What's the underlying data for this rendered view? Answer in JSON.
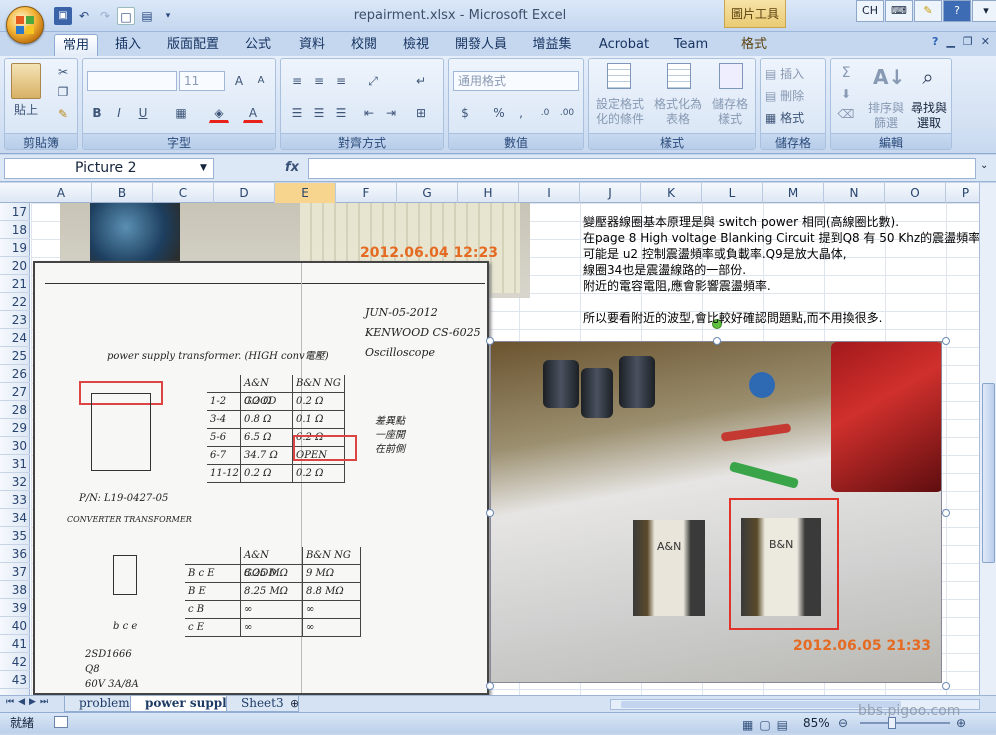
{
  "window": {
    "title": "repairment.xlsx - Microsoft Excel",
    "context_tool_label": "圖片工具",
    "sys_buttons": [
      "CH",
      "?"
    ]
  },
  "tabs": [
    "常用",
    "插入",
    "版面配置",
    "公式",
    "資料",
    "校閱",
    "檢視",
    "開發人員",
    "增益集",
    "Acrobat",
    "Team",
    "格式"
  ],
  "ribbon": {
    "clipboard": {
      "label": "剪貼簿",
      "paste": "貼上"
    },
    "font": {
      "label": "字型",
      "size": "11",
      "bold": "B",
      "italic": "I",
      "underline": "U"
    },
    "alignment": {
      "label": "對齊方式"
    },
    "number": {
      "label": "數值",
      "format": "通用格式",
      "percent": "%",
      "comma": ","
    },
    "styles": {
      "label": "樣式",
      "cond_format": "設定格式化的條件",
      "as_table": "格式化為表格",
      "cell_styles": "儲存格樣式"
    },
    "cells": {
      "label": "儲存格",
      "insert": "插入",
      "delete": "刪除",
      "format": "格式"
    },
    "editing": {
      "label": "編輯",
      "sigma": "Σ",
      "sort": "排序與篩選",
      "find": "尋找與選取"
    }
  },
  "formula_bar": {
    "name_box": "Picture 2",
    "fx": "fx",
    "value": ""
  },
  "columns": [
    "A",
    "B",
    "C",
    "D",
    "E",
    "F",
    "G",
    "H",
    "I",
    "J",
    "K",
    "L",
    "M",
    "N",
    "O",
    "P"
  ],
  "rows": [
    "17",
    "18",
    "19",
    "20",
    "21",
    "22",
    "23",
    "24",
    "25",
    "26",
    "27",
    "28",
    "29",
    "30",
    "31",
    "32",
    "33",
    "34",
    "35",
    "36",
    "37",
    "38",
    "39",
    "40",
    "41",
    "42",
    "43"
  ],
  "note_lines": [
    "變壓器線圈基本原理是與  switch power 相同(高線圈比數).",
    "在page 8 High voltage  Blanking Circuit  提到Q8 有 50 Khz的震盪頻率,",
    "可能是 u2 控制震盪頻率或負載率.Q9是放大晶体,",
    "線圈34也是震盪線路的一部份.",
    "附近的電容電阻,應會影響震盪頻率.",
    "",
    "所以要看附近的波型,會比較好確認問題點,而不用換很多."
  ],
  "photos": {
    "top_timestamp": "2012.06.04 12:23",
    "main_timestamp": "2012.06.05 21:33",
    "label_left": "A&N",
    "label_right": "B&N"
  },
  "handwritten": {
    "date": "JUN-05-2012",
    "model": "KENWOOD CS-6025",
    "device": "Oscilloscope",
    "title": "power supply transformer. (HIGH conv電壓)",
    "pn": "P/N: L19-0427-05",
    "pn_sub": "CONVERTER TRANSFORMER",
    "table1_head": [
      "",
      "A&N GOOD",
      "B&N NG"
    ],
    "table1_rows": [
      [
        "1-2",
        "0.2 Ω",
        "0.2 Ω"
      ],
      [
        "3-4",
        "0.8 Ω",
        "0.1 Ω"
      ],
      [
        "5-6",
        "6.5 Ω",
        "6.2 Ω"
      ],
      [
        "6-7",
        "34.7 Ω",
        "OPEN"
      ],
      [
        "11-12",
        "0.2 Ω",
        "0.2 Ω"
      ]
    ],
    "side_note": [
      "差異點",
      "一座開",
      "在前側"
    ],
    "table2_head": [
      "",
      "A&N GOOD",
      "B&N NG"
    ],
    "table2_rows": [
      [
        "B c E",
        "8.25 MΩ",
        "9 MΩ"
      ],
      [
        "B E",
        "8.25 MΩ",
        "8.8 MΩ"
      ],
      [
        "c B",
        "∞",
        "∞"
      ],
      [
        "c E",
        "∞",
        "∞"
      ]
    ],
    "transistor": [
      "2SD1666",
      "Q8",
      "60V 3A/8A"
    ],
    "pins": "b c e"
  },
  "sheet_tabs": [
    "problems",
    "power supply",
    "Sheet3"
  ],
  "active_sheet": "power supply",
  "status": {
    "ready": "就緒",
    "zoom": "85%",
    "watermark": "bbs.pigoo.com"
  }
}
